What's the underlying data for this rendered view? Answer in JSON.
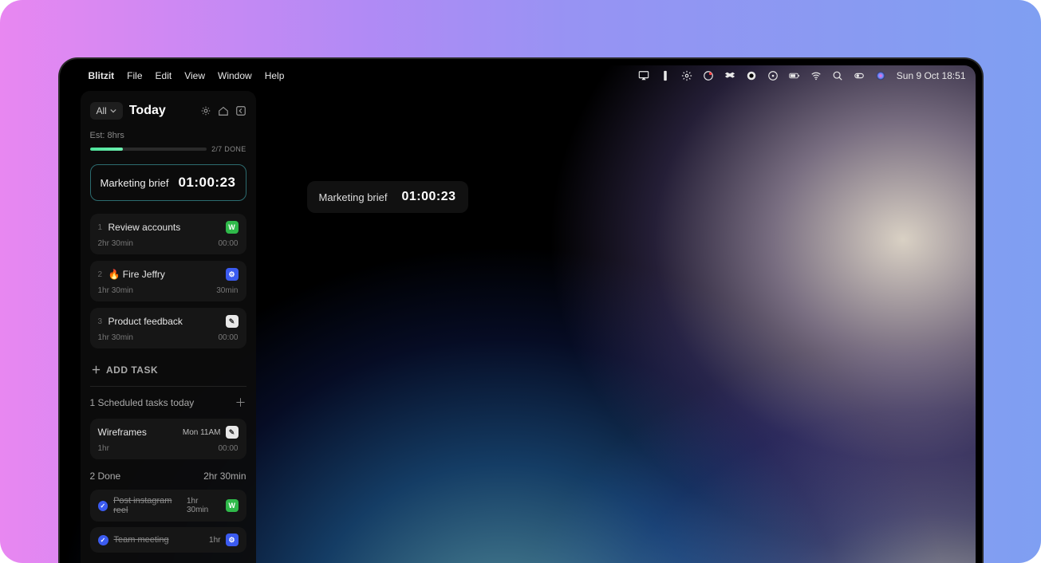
{
  "menubar": {
    "app": "Blitzit",
    "items": [
      "File",
      "Edit",
      "View",
      "Window",
      "Help"
    ],
    "clock": "Sun 9 Oct  18:51"
  },
  "sidebar": {
    "filter": "All",
    "title": "Today",
    "estimate": "Est: 8hrs",
    "progress_text": "2/7 DONE"
  },
  "current": {
    "name": "Marketing brief",
    "timer": "01:00:23"
  },
  "tasks": [
    {
      "num": "1",
      "name": "Review accounts",
      "est": "2hr 30min",
      "elapsed": "00:00",
      "badge": "W",
      "badge_cls": "badge-green"
    },
    {
      "num": "2",
      "name": "🔥 Fire Jeffry",
      "est": "1hr 30min",
      "elapsed": "30min",
      "badge": "⚙",
      "badge_cls": "badge-blue"
    },
    {
      "num": "3",
      "name": "Product feedback",
      "est": "1hr 30min",
      "elapsed": "00:00",
      "badge": "✎",
      "badge_cls": "badge-white"
    }
  ],
  "add_task": "ADD TASK",
  "scheduled": {
    "header": "1 Scheduled tasks today",
    "item": {
      "name": "Wireframes",
      "when": "Mon 11AM",
      "est": "1hr",
      "elapsed": "00:00"
    }
  },
  "done": {
    "header": "2 Done",
    "total": "2hr 30min",
    "items": [
      {
        "name": "Post instagram reel",
        "dur": "1hr 30min",
        "badge": "W",
        "badge_cls": "badge-green"
      },
      {
        "name": "Team meeting",
        "dur": "1hr",
        "badge": "⚙",
        "badge_cls": "badge-blue"
      }
    ]
  },
  "floater": {
    "name": "Marketing brief",
    "timer": "01:00:23"
  }
}
